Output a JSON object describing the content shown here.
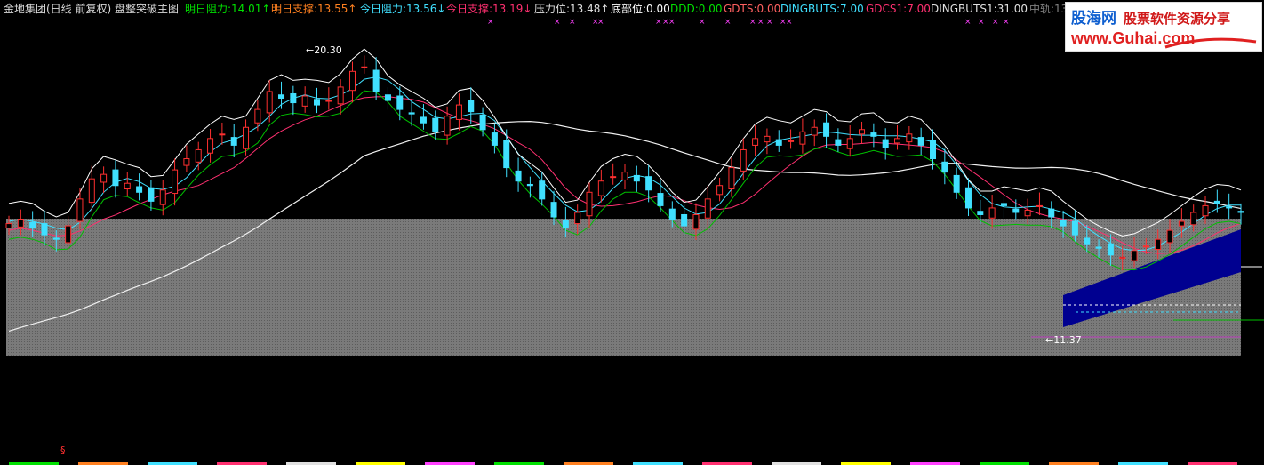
{
  "header": {
    "items": [
      {
        "text": "金地集团(日线 前复权) 盘整突破主图",
        "color": "#d8d8d8"
      },
      {
        "text": "明日阻力:14.01↑",
        "color": "#00e000"
      },
      {
        "text": "明日支撑:13.55↑",
        "color": "#ff8020"
      },
      {
        "text": "今日阻力:13.56↓",
        "color": "#40e0ff"
      },
      {
        "text": "今日支撑:13.19↓",
        "color": "#ff3070"
      },
      {
        "text": "压力位:13.48↑",
        "color": "#e0e0e0"
      },
      {
        "text": "底部位:0.00",
        "color": "#ffffff"
      },
      {
        "text": "DDD:0.00",
        "color": "#00e000"
      },
      {
        "text": "GDTS:0.00",
        "color": "#ff6060"
      },
      {
        "text": "DINGBUTS:7.00",
        "color": "#40e0ff"
      },
      {
        "text": "GDCS1:7.00",
        "color": "#ff3070"
      },
      {
        "text": "DINGBUTS1:31.00",
        "color": "#e0e0e0"
      },
      {
        "text": "中轨:13",
        "color": "#808080"
      }
    ]
  },
  "watermark": {
    "logo": "股海网",
    "tagline": "股票软件资源分享",
    "url": "www.Guhai.com"
  },
  "chart_data": {
    "type": "candlestick",
    "high_label": "20.30",
    "low_label": "←11.37",
    "band_color": "#7a7a7a",
    "channel_color": "#000090",
    "up_color": "#ff3030",
    "down_color": "#40e0ff",
    "marker": "§",
    "ylim": [
      8.0,
      21.5
    ],
    "series": [
      {
        "name": "ma_short",
        "color": "#ffffff"
      },
      {
        "name": "ma_mid",
        "color": "#40e0ff"
      },
      {
        "name": "ma_low",
        "color": "#00c000"
      },
      {
        "name": "ma_red",
        "color": "#ff3070"
      },
      {
        "name": "ma_long",
        "color": "#f0f0f0"
      }
    ],
    "closes": [
      13.1,
      13.3,
      12.9,
      12.6,
      12.4,
      13.0,
      14.2,
      15.1,
      15.3,
      14.8,
      14.9,
      14.5,
      14.1,
      14.6,
      15.5,
      16.0,
      16.4,
      16.9,
      17.1,
      16.6,
      17.4,
      18.2,
      19.0,
      18.7,
      18.5,
      18.8,
      18.4,
      18.6,
      19.2,
      19.9,
      20.1,
      19.0,
      18.6,
      18.2,
      18.0,
      17.6,
      17.2,
      17.9,
      18.4,
      18.1,
      17.3,
      16.6,
      15.6,
      15.0,
      14.8,
      14.2,
      13.4,
      12.9,
      13.6,
      14.5,
      15.0,
      15.2,
      15.4,
      15.0,
      14.6,
      13.9,
      13.3,
      13.0,
      13.5,
      14.2,
      14.8,
      15.6,
      16.4,
      16.9,
      17.0,
      16.6,
      16.8,
      17.2,
      17.4,
      17.0,
      16.6,
      16.9,
      17.3,
      17.0,
      16.5,
      16.9,
      17.1,
      16.6,
      16.0,
      15.4,
      14.5,
      13.8,
      13.5,
      13.8,
      13.9,
      13.6,
      13.7,
      13.9,
      13.4,
      13.0,
      12.6,
      12.2,
      12.0,
      11.7,
      11.6,
      11.9,
      12.1,
      12.4,
      12.8,
      13.2,
      13.6,
      13.9,
      14.0,
      13.8,
      13.6
    ]
  }
}
